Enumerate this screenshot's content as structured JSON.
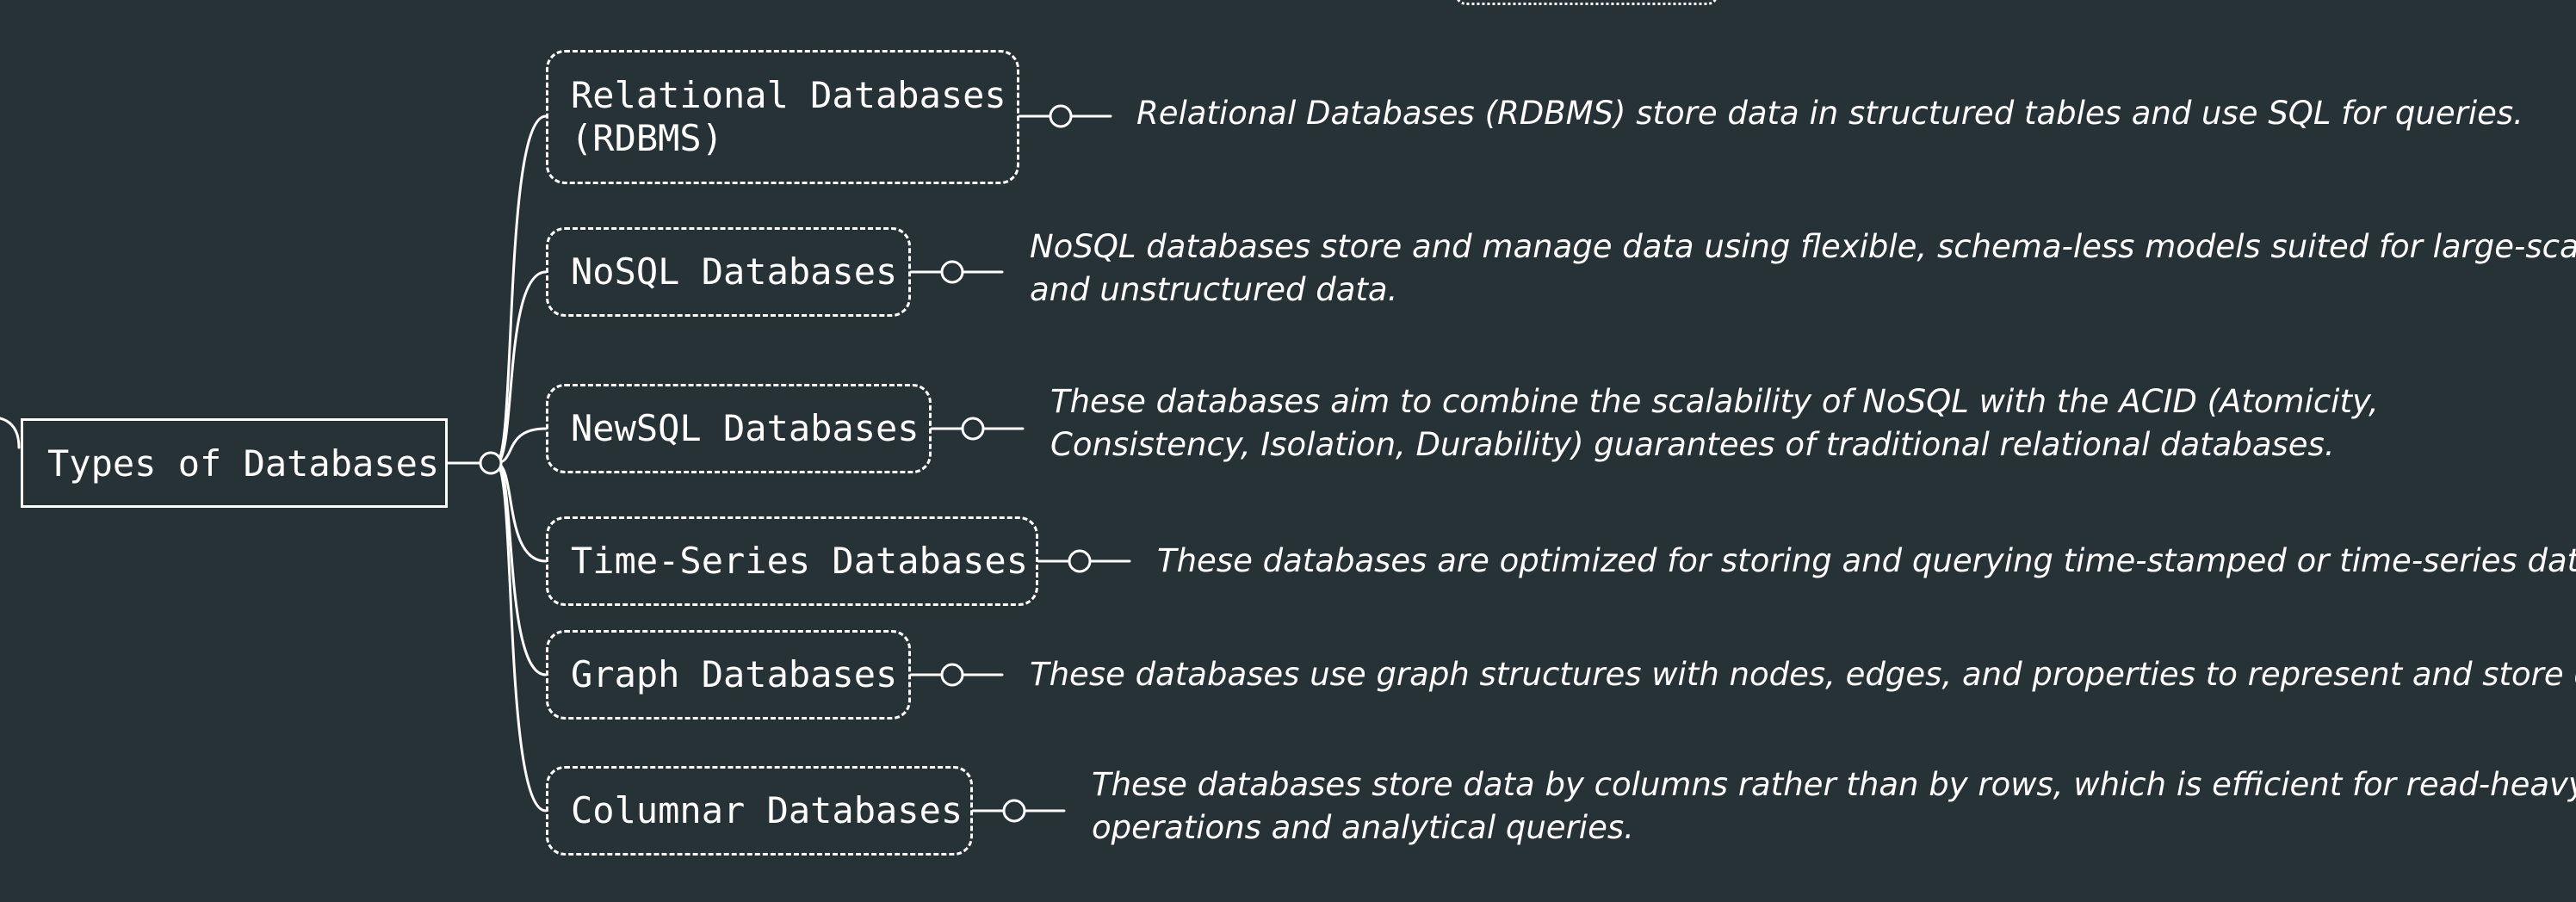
{
  "diagram": {
    "root": {
      "label": "Types of Databases"
    },
    "children": [
      {
        "label": "Relational Databases\n(RDBMS)",
        "description": [
          "Relational Databases (RDBMS) store data in structured tables and use SQL for queries."
        ]
      },
      {
        "label": "NoSQL Databases",
        "description": [
          "NoSQL databases store and manage data using flexible, schema-less models suited for large-scale",
          "and unstructured data."
        ]
      },
      {
        "label": "NewSQL Databases",
        "description": [
          "These databases aim to combine the scalability of NoSQL with the ACID (Atomicity,",
          "Consistency, Isolation, Durability) guarantees of traditional relational databases."
        ]
      },
      {
        "label": "Time-Series Databases",
        "description": [
          "These databases are optimized for storing and querying time-stamped or time-series data."
        ]
      },
      {
        "label": "Graph Databases",
        "description": [
          "These databases use graph structures with nodes, edges, and properties to represent and store data."
        ]
      },
      {
        "label": "Columnar Databases",
        "description": [
          "These databases store data by columns rather than by rows, which is efficient for read-heavy",
          "operations and analytical queries."
        ]
      }
    ],
    "colors": {
      "background": "#273236",
      "line": "#ffffff",
      "text": "#ffffff"
    }
  }
}
